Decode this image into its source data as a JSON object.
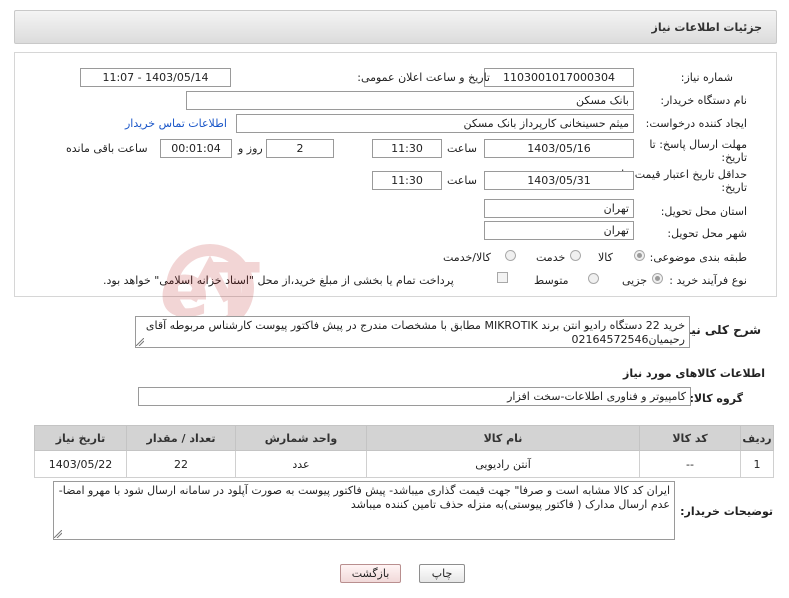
{
  "header": {
    "title": "جزئیات اطلاعات نیاز"
  },
  "labels": {
    "need_number": "شماره نیاز:",
    "announce_datetime": "تاریخ و ساعت اعلان عمومی:",
    "buyer_org": "نام دستگاه خریدار:",
    "requester": "ایجاد کننده درخواست:",
    "contact_link": "اطلاعات تماس خریدار",
    "reply_deadline_1": "مهلت ارسال پاسخ: تا",
    "reply_deadline_2": "تاریخ:",
    "time": "ساعت",
    "day_and": "روز و",
    "remaining": "ساعت باقی مانده",
    "price_validity_1": "حداقل تاریخ اعتبار قیمت: تا",
    "price_validity_2": "تاریخ:",
    "province": "استان محل تحویل:",
    "city": "شهر محل تحویل:",
    "category": "طبقه بندی موضوعی:",
    "process_type": "نوع فرآیند خرید :",
    "general_desc": "شرح کلی نیاز:",
    "goods_info": "اطلاعات کالاهای مورد نیاز",
    "goods_group": "گروه کالا:",
    "buyer_notes": "توضیحات خریدار:"
  },
  "values": {
    "need_number": "1103001017000304",
    "announce_datetime": "1403/05/14 - 11:07",
    "buyer_org": "بانک مسکن",
    "requester": "میثم حسینخانی کارپرداز بانک مسکن",
    "reply_date": "1403/05/16",
    "reply_time": "11:30",
    "reply_days": "2",
    "remaining_time": "00:01:04",
    "validity_date": "1403/05/31",
    "validity_time": "11:30",
    "province": "تهران",
    "city": "تهران",
    "general_desc": "خرید 22 دستگاه رادیو انتن برند MIKROTIK مطابق با مشخصات مندرج در پیش فاکتور پیوست کارشناس مربوطه آقای رحیمیان02164572546",
    "goods_group": "کامپیوتر و فناوری اطلاعات-سخت افزار",
    "buyer_notes": "ایران کد کالا مشابه است و صرفا\" جهت قیمت گذاری میباشد- پیش فاکتور پیوست به صورت آپلود در سامانه ارسال شود با مهرو امضا-عدم ارسال مدارک ( فاکتور پیوستی)به منزله حذف تامین کننده میباشد"
  },
  "category_options": [
    "کالا",
    "خدمت",
    "کالا/خدمت"
  ],
  "process_options": [
    "جزیی",
    "متوسط"
  ],
  "payment_note": "پرداخت تمام یا بخشی از مبلغ خرید،از محل \"اسناد خزانه اسلامی\" خواهد بود.",
  "table": {
    "headers": [
      "ردیف",
      "کد کالا",
      "نام کالا",
      "واحد شمارش",
      "تعداد / مقدار",
      "تاریخ نیاز"
    ],
    "rows": [
      [
        "1",
        "--",
        "آنتن رادیویی",
        "عدد",
        "22",
        "1403/05/22"
      ]
    ]
  },
  "buttons": {
    "print": "چاپ",
    "back": "بازگشت"
  },
  "watermark": "AriaTender.neT",
  "colors": {
    "link": "#1a56c8",
    "header_bg": "#e2e2e2",
    "table_header": "#d3d3d3"
  }
}
